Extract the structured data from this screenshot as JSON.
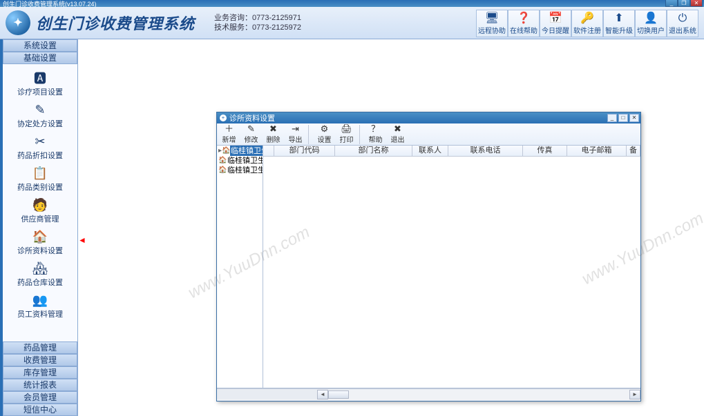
{
  "window": {
    "title": "创生门诊收费管理系统(v13.07.24)"
  },
  "header": {
    "app_name": "创生门诊收费管理系统",
    "contact_line1": "业务咨询：0773-2125971",
    "contact_line2": "技术服务：0773-2125972",
    "tools": [
      {
        "icon": "🖥",
        "label": "远程协助"
      },
      {
        "icon": "❓",
        "label": "在线帮助"
      },
      {
        "icon": "📅",
        "label": "今日提醒"
      },
      {
        "icon": "🔑",
        "label": "软件注册"
      },
      {
        "icon": "⬆",
        "label": "智能升级"
      },
      {
        "icon": "👤",
        "label": "切换用户"
      },
      {
        "icon": "⏻",
        "label": "退出系统"
      }
    ]
  },
  "sidebar": {
    "top_headers": [
      "系统设置",
      "基础设置"
    ],
    "items": [
      {
        "icon": "🅰",
        "label": "诊疗项目设置"
      },
      {
        "icon": "✎",
        "label": "协定处方设置"
      },
      {
        "icon": "✂",
        "label": "药品折扣设置"
      },
      {
        "icon": "📋",
        "label": "药品类别设置"
      },
      {
        "icon": "🧑",
        "label": "供应商管理"
      },
      {
        "icon": "🏠",
        "label": "诊所资料设置"
      },
      {
        "icon": "🏘",
        "label": "药品仓库设置"
      },
      {
        "icon": "👥",
        "label": "员工资料管理"
      }
    ],
    "bottom_headers": [
      "药品管理",
      "收费管理",
      "库存管理",
      "统计报表",
      "会员管理",
      "短信中心"
    ]
  },
  "dialog": {
    "title": "诊所资料设置",
    "toolbar": [
      {
        "icon": "＋",
        "label": "新增"
      },
      {
        "icon": "✎",
        "label": "修改"
      },
      {
        "icon": "✖",
        "label": "删除"
      },
      {
        "icon": "⇥",
        "label": "导出"
      },
      {
        "sep": true
      },
      {
        "icon": "⚙",
        "label": "设置"
      },
      {
        "icon": "🖨",
        "label": "打印"
      },
      {
        "sep": true
      },
      {
        "icon": "？",
        "label": "帮助"
      },
      {
        "icon": "✖",
        "label": "退出"
      }
    ],
    "tree": [
      {
        "glyph": "▸",
        "icon": "🏠",
        "label": "临桂镇卫生院榕山门诊部",
        "selected": true
      },
      {
        "glyph": "",
        "icon": "🏠",
        "label": "临桂镇卫生院虎山门诊部"
      },
      {
        "glyph": "",
        "icon": "🏠",
        "label": "临桂镇卫生院桂康门诊部"
      }
    ],
    "grid_columns": [
      {
        "label": "",
        "w": 16
      },
      {
        "label": "部门代码",
        "w": 88
      },
      {
        "label": "部门名称",
        "w": 112
      },
      {
        "label": "联系人",
        "w": 52
      },
      {
        "label": "联系电话",
        "w": 108
      },
      {
        "label": "传真",
        "w": 64
      },
      {
        "label": "电子邮箱",
        "w": 86
      },
      {
        "label": "备",
        "w": 20
      }
    ]
  },
  "watermark": "www.YuuDnn.com"
}
